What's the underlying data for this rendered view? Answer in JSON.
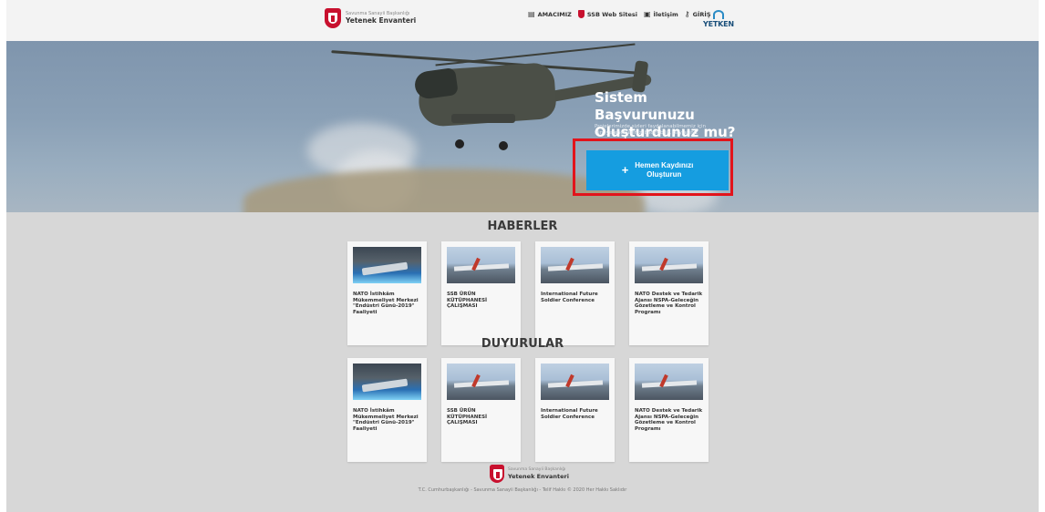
{
  "header": {
    "logo_sub": "Savunma Sanayii Başkanlığı",
    "logo_main": "Yetenek Envanteri",
    "nav": [
      {
        "icon": "book-icon",
        "label": "AMACIMIZ"
      },
      {
        "icon": "ssb-logo-icon",
        "label": "SSB Web Sitesi"
      },
      {
        "icon": "contact-icon",
        "label": "İletişim"
      },
      {
        "icon": "key-icon",
        "label": "GİRİŞ"
      }
    ],
    "yetken": "YETKEN"
  },
  "hero": {
    "title_line1": "Sistem Başvurunuzu",
    "title_line2": "Oluşturdunuz mu?",
    "desc_line1": "Projelerimizde sizleri faydalanabilmemiz için",
    "desc_line2": "tüm yeteneklerinizi bildirebilir, paylaşınız",
    "cta_plus": "+",
    "cta_line1": "Hemen Kaydınızı",
    "cta_line2": "Oluşturun"
  },
  "news": {
    "title": "HABERLER",
    "cards": [
      {
        "title": "NATO İstihkâm Mükemmeliyet Merkezi \"Endüstri Günü-2019\" Faaliyeti",
        "image": "model-exhibit"
      },
      {
        "title": "SSB ÜRÜN KÜTÜPHANESİ ÇALIŞMASI",
        "image": "aircraft"
      },
      {
        "title": "International Future Soldier Conference",
        "image": "aircraft"
      },
      {
        "title": "NATO Destek ve Tedarik Ajansı NSPA-Geleceğin Gözetleme ve Kontrol Programı",
        "image": "aircraft"
      }
    ]
  },
  "announcements": {
    "title": "DUYURULAR",
    "cards": [
      {
        "title": "NATO İstihkâm Mükemmeliyet Merkezi \"Endüstri Günü-2019\" Faaliyeti",
        "image": "model-exhibit"
      },
      {
        "title": "SSB ÜRÜN KÜTÜPHANESİ ÇALIŞMASI",
        "image": "aircraft"
      },
      {
        "title": "International Future Soldier Conference",
        "image": "aircraft"
      },
      {
        "title": "NATO Destek ve Tedarik Ajansı NSPA-Geleceğin Gözetleme ve Kontrol Programı",
        "image": "aircraft"
      }
    ]
  },
  "footer": {
    "logo_sub": "Savunma Sanayii Başkanlığı",
    "logo_main": "Yetenek Envanteri",
    "copyright": "T.C. Cumhurbaşkanlığı - Savunma Sanayii Başkanlığı - Telif Hakkı © 2020 Her Hakkı Saklıdır"
  },
  "colors": {
    "accent": "#159de0",
    "highlight": "#e2141b",
    "brand": "#c8102e"
  }
}
